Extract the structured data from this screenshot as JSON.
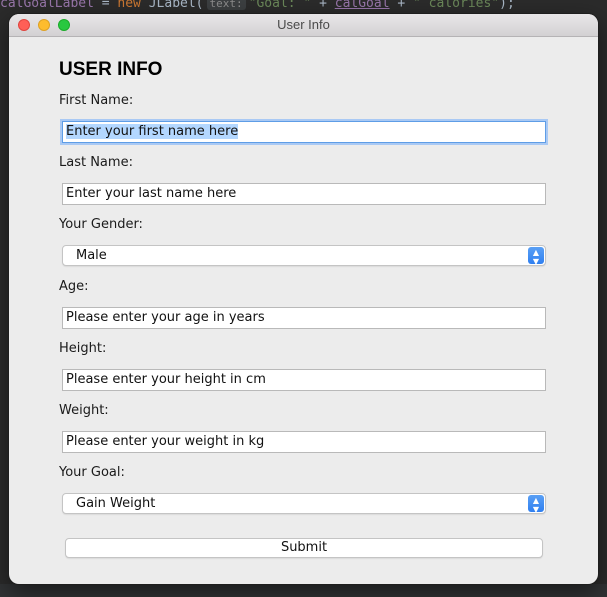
{
  "ide": {
    "code_var": "calGoalLabel",
    "code_eq": " = ",
    "code_new": "new",
    "code_class": " JLabel(",
    "code_hint": "text:",
    "code_str1": "\"Goal: \"",
    "code_plus1": " + ",
    "code_var2": "calGoal",
    "code_plus2": " + ",
    "code_str2": "\" calories\"",
    "code_end": ");"
  },
  "window": {
    "title": "User Info"
  },
  "form": {
    "heading": "USER INFO",
    "first_name_label": "First Name:",
    "first_name_value": "Enter your first name here",
    "last_name_label": "Last Name:",
    "last_name_value": "Enter your last name here",
    "gender_label": "Your Gender:",
    "gender_value": "Male",
    "age_label": "Age:",
    "age_value": "Please enter your age in years",
    "height_label": "Height:",
    "height_value": "Please enter your height in cm",
    "weight_label": "Weight:",
    "weight_value": "Please enter your weight in kg",
    "goal_label": "Your Goal:",
    "goal_value": "Gain Weight",
    "submit_label": "Submit"
  },
  "colors": {
    "window_bg": "#ececec",
    "focus_ring": "#5e9de6",
    "selection": "#b3d7ff",
    "select_arrow": "#2f7ff0"
  },
  "icons": {
    "select_arrow": "chevron-up-down-icon"
  }
}
